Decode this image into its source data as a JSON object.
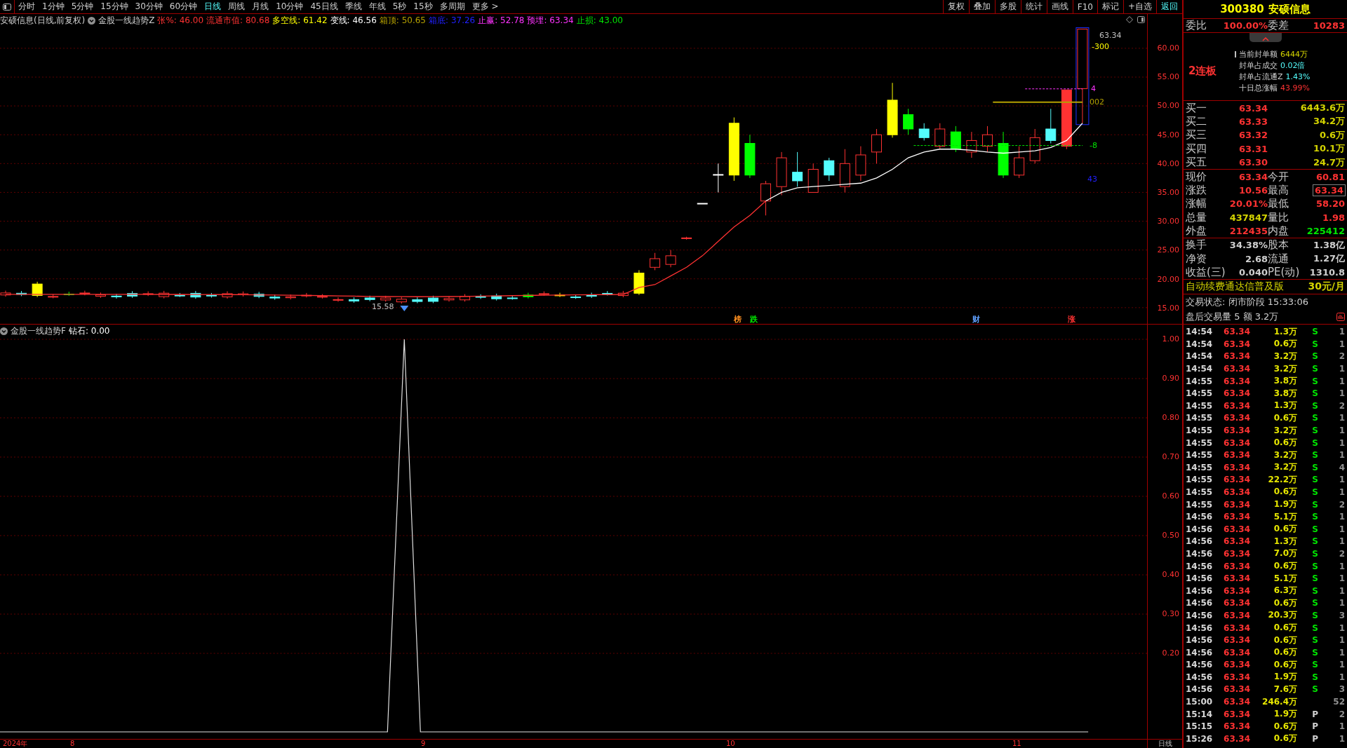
{
  "toolbar": {
    "periods": [
      {
        "label": "分时",
        "selected": false
      },
      {
        "label": "1分钟",
        "selected": false
      },
      {
        "label": "5分钟",
        "selected": false
      },
      {
        "label": "15分钟",
        "selected": false
      },
      {
        "label": "30分钟",
        "selected": false
      },
      {
        "label": "60分钟",
        "selected": false
      },
      {
        "label": "日线",
        "selected": true
      },
      {
        "label": "周线",
        "selected": false
      },
      {
        "label": "月线",
        "selected": false
      },
      {
        "label": "10分钟",
        "selected": false
      },
      {
        "label": "45日线",
        "selected": false
      },
      {
        "label": "季线",
        "selected": false
      },
      {
        "label": "年线",
        "selected": false
      },
      {
        "label": "5秒",
        "selected": false
      },
      {
        "label": "15秒",
        "selected": false
      },
      {
        "label": "多周期",
        "selected": false
      }
    ],
    "more": "更多 >",
    "actions": [
      {
        "label": "复权",
        "selected": false
      },
      {
        "label": "叠加",
        "selected": false
      },
      {
        "label": "多股",
        "selected": false
      },
      {
        "label": "统计",
        "selected": false
      },
      {
        "label": "画线",
        "selected": false
      },
      {
        "label": "F10",
        "selected": false
      },
      {
        "label": "标记",
        "selected": false
      },
      {
        "label": "+自选",
        "selected": false
      },
      {
        "label": "返回",
        "selected": true
      }
    ]
  },
  "chart_header": {
    "title": "安硕信息(日线,前复权)",
    "indicator": "金股一线趋势Z",
    "values": [
      {
        "label": "张%:",
        "value": "46.00",
        "color": "#ff3232"
      },
      {
        "label": "流通市值:",
        "value": "80.68",
        "color": "#ff3232"
      },
      {
        "label": "多空线:",
        "value": "61.42",
        "color": "#ffff00"
      },
      {
        "label": "变线:",
        "value": "46.56",
        "color": "#ffffff"
      },
      {
        "label": "箱顶:",
        "value": "50.65",
        "color": "#b4a000"
      },
      {
        "label": "箱底:",
        "value": "37.26",
        "color": "#2020ff"
      },
      {
        "label": "止赢:",
        "value": "52.78",
        "color": "#ff32ff"
      },
      {
        "label": "预埋:",
        "value": "63.34",
        "color": "#ff32ff"
      },
      {
        "label": "止损:",
        "value": "43.00",
        "color": "#00e600"
      }
    ]
  },
  "price_axis": [
    "60.00",
    "55.00",
    "50.00",
    "45.00",
    "40.00",
    "35.00",
    "30.00",
    "25.00",
    "20.00",
    "15.00"
  ],
  "chart_labels": [
    {
      "text": "63.34",
      "color": "#c0c0c0"
    },
    {
      "text": "-300",
      "color": "#ffff00"
    },
    {
      "text": "4",
      "color": "#ff32ff"
    },
    {
      "text": "002",
      "color": "#b4a000"
    },
    {
      "text": "-8",
      "color": "#00e600"
    },
    {
      "text": "43",
      "color": "#2020ff"
    },
    {
      "text": "15.58",
      "color": "#c0c0c0"
    }
  ],
  "event_marks": [
    {
      "label": "榜",
      "color": "#ff9020"
    },
    {
      "label": "跌",
      "color": "#00e600"
    },
    {
      "label": "财",
      "color": "#60a0ff"
    },
    {
      "label": "涨",
      "color": "#ff3232"
    }
  ],
  "indicator_panel": {
    "title": "金股一线趋势F",
    "reading_label": "钻石:",
    "reading": "0.00",
    "axis": [
      "1.00",
      "0.90",
      "0.80",
      "0.70",
      "0.60",
      "0.50",
      "0.40",
      "0.30",
      "0.20"
    ]
  },
  "date_axis": {
    "labels": [
      "2024年",
      "8",
      "9",
      "10",
      "11"
    ],
    "period": "日线"
  },
  "quote": {
    "code": "300380",
    "name": "安硕信息",
    "order_ratio": {
      "label": "委比",
      "value": "100.00%",
      "diff_label": "委差",
      "diff": "10283"
    },
    "limit_up": {
      "streak": "2连板",
      "lines": [
        {
          "label": "当前封单额",
          "value": "6444万",
          "color": "#d4d400"
        },
        {
          "label": "封单占成交",
          "value": "0.02倍",
          "color": "#54fcfc"
        },
        {
          "label": "封单占流通Z",
          "value": "1.43%",
          "color": "#54fcfc"
        },
        {
          "label": "十日总涨幅",
          "value": "43.99%",
          "color": "#ff3232"
        }
      ]
    },
    "bids": [
      {
        "label": "买一",
        "price": "63.34",
        "volume": "6443.6万"
      },
      {
        "label": "买二",
        "price": "63.33",
        "volume": "34.2万"
      },
      {
        "label": "买三",
        "price": "63.32",
        "volume": "0.6万"
      },
      {
        "label": "买四",
        "price": "63.31",
        "volume": "10.1万"
      },
      {
        "label": "买五",
        "price": "63.30",
        "volume": "24.7万"
      }
    ],
    "stats": [
      {
        "left": {
          "label": "现价",
          "value": "63.34",
          "color": "#ff3232"
        },
        "right": {
          "label": "今开",
          "value": "60.81",
          "color": "#ff3232",
          "boxed": false
        }
      },
      {
        "left": {
          "label": "涨跌",
          "value": "10.56",
          "color": "#ff3232"
        },
        "right": {
          "label": "最高",
          "value": "63.34",
          "color": "#ff3232",
          "boxed": true
        }
      },
      {
        "left": {
          "label": "涨幅",
          "value": "20.01%",
          "color": "#ff3232"
        },
        "right": {
          "label": "最低",
          "value": "58.20",
          "color": "#ff3232",
          "boxed": false
        }
      },
      {
        "left": {
          "label": "总量",
          "value": "437847",
          "color": "#d4d400"
        },
        "right": {
          "label": "量比",
          "value": "1.98",
          "color": "#ff3232",
          "boxed": false
        }
      },
      {
        "left": {
          "label": "外盘",
          "value": "212435",
          "color": "#ff3232"
        },
        "right": {
          "label": "内盘",
          "value": "225412",
          "color": "#00e600",
          "boxed": false
        }
      }
    ],
    "fundamentals": [
      {
        "label": "换手",
        "value": "34.38%",
        "label2": "股本",
        "value2": "1.38亿"
      },
      {
        "label": "净资",
        "value": "2.68",
        "label2": "流通",
        "value2": "1.27亿"
      },
      {
        "label": "收益(三)",
        "value": "0.040",
        "label2": "PE(动)",
        "value2": "1310.8"
      }
    ],
    "promo": {
      "text": "自动续费通达信普及版",
      "price": "30元/月"
    },
    "status": [
      "交易状态: 闭市阶段 15:33:06",
      "盘后交易量 5 额 3.2万"
    ],
    "ticks": [
      {
        "time": "14:54",
        "price": "63.34",
        "volume": "1.3万",
        "side": "S",
        "count": "1"
      },
      {
        "time": "14:54",
        "price": "63.34",
        "volume": "0.6万",
        "side": "S",
        "count": "1"
      },
      {
        "time": "14:54",
        "price": "63.34",
        "volume": "3.2万",
        "side": "S",
        "count": "2"
      },
      {
        "time": "14:54",
        "price": "63.34",
        "volume": "3.2万",
        "side": "S",
        "count": "1"
      },
      {
        "time": "14:55",
        "price": "63.34",
        "volume": "3.8万",
        "side": "S",
        "count": "1"
      },
      {
        "time": "14:55",
        "price": "63.34",
        "volume": "3.8万",
        "side": "S",
        "count": "1"
      },
      {
        "time": "14:55",
        "price": "63.34",
        "volume": "1.3万",
        "side": "S",
        "count": "2"
      },
      {
        "time": "14:55",
        "price": "63.34",
        "volume": "0.6万",
        "side": "S",
        "count": "1"
      },
      {
        "time": "14:55",
        "price": "63.34",
        "volume": "3.2万",
        "side": "S",
        "count": "1"
      },
      {
        "time": "14:55",
        "price": "63.34",
        "volume": "0.6万",
        "side": "S",
        "count": "1"
      },
      {
        "time": "14:55",
        "price": "63.34",
        "volume": "3.2万",
        "side": "S",
        "count": "1"
      },
      {
        "time": "14:55",
        "price": "63.34",
        "volume": "3.2万",
        "side": "S",
        "count": "4"
      },
      {
        "time": "14:55",
        "price": "63.34",
        "volume": "22.2万",
        "side": "S",
        "count": "1"
      },
      {
        "time": "14:55",
        "price": "63.34",
        "volume": "0.6万",
        "side": "S",
        "count": "1"
      },
      {
        "time": "14:55",
        "price": "63.34",
        "volume": "1.9万",
        "side": "S",
        "count": "2"
      },
      {
        "time": "14:56",
        "price": "63.34",
        "volume": "5.1万",
        "side": "S",
        "count": "1"
      },
      {
        "time": "14:56",
        "price": "63.34",
        "volume": "0.6万",
        "side": "S",
        "count": "1"
      },
      {
        "time": "14:56",
        "price": "63.34",
        "volume": "1.3万",
        "side": "S",
        "count": "1"
      },
      {
        "time": "14:56",
        "price": "63.34",
        "volume": "7.0万",
        "side": "S",
        "count": "2"
      },
      {
        "time": "14:56",
        "price": "63.34",
        "volume": "0.6万",
        "side": "S",
        "count": "1"
      },
      {
        "time": "14:56",
        "price": "63.34",
        "volume": "5.1万",
        "side": "S",
        "count": "1"
      },
      {
        "time": "14:56",
        "price": "63.34",
        "volume": "6.3万",
        "side": "S",
        "count": "1"
      },
      {
        "time": "14:56",
        "price": "63.34",
        "volume": "0.6万",
        "side": "S",
        "count": "1"
      },
      {
        "time": "14:56",
        "price": "63.34",
        "volume": "20.3万",
        "side": "S",
        "count": "3"
      },
      {
        "time": "14:56",
        "price": "63.34",
        "volume": "0.6万",
        "side": "S",
        "count": "1"
      },
      {
        "time": "14:56",
        "price": "63.34",
        "volume": "0.6万",
        "side": "S",
        "count": "1"
      },
      {
        "time": "14:56",
        "price": "63.34",
        "volume": "0.6万",
        "side": "S",
        "count": "1"
      },
      {
        "time": "14:56",
        "price": "63.34",
        "volume": "0.6万",
        "side": "S",
        "count": "1"
      },
      {
        "time": "14:56",
        "price": "63.34",
        "volume": "1.9万",
        "side": "S",
        "count": "1"
      },
      {
        "time": "14:56",
        "price": "63.34",
        "volume": "7.6万",
        "side": "S",
        "count": "3"
      },
      {
        "time": "15:00",
        "price": "63.34",
        "volume": "246.4万",
        "count": "52"
      },
      {
        "time": "15:14",
        "price": "63.34",
        "volume": "1.9万",
        "side": "P",
        "count": "2"
      },
      {
        "time": "15:15",
        "price": "63.34",
        "volume": "0.6万",
        "side": "P",
        "count": "1"
      },
      {
        "time": "15:26",
        "price": "63.34",
        "volume": "0.6万",
        "side": "P",
        "count": "1"
      }
    ]
  }
}
